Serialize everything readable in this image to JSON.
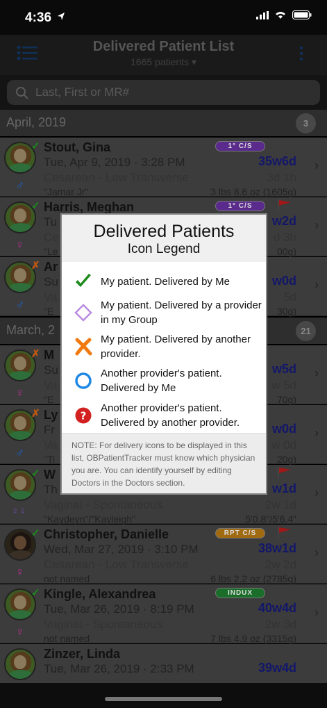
{
  "status_bar": {
    "time": "4:36"
  },
  "nav": {
    "title": "Delivered Patient List",
    "subtitle": "1665 patients ▾"
  },
  "search": {
    "placeholder": "Last, First or MR#"
  },
  "sections": [
    {
      "title": "April, 2019",
      "count": "3"
    },
    {
      "title": "March, 2",
      "count": "21"
    }
  ],
  "rows": [
    {
      "name": "Stout, Gina",
      "date": "Tue, Apr 9, 2019 · 3:28 PM",
      "delivery": "Cesarean - Low Transverse",
      "baby": "\"Jamar Jr\"",
      "age": "35w6d",
      "since": "3d 1h",
      "weight": "3 lbs 8.6 oz (1605g)",
      "badge": "1° C/S",
      "gender": "♂"
    },
    {
      "name": "Harris, Meghan",
      "date": "Tu",
      "delivery": "Ce",
      "baby": "\"Le",
      "age": "w2d",
      "since": "d 3h",
      "weight": "00g)",
      "badge": "1° C/S",
      "gender": "♀"
    },
    {
      "name": "Ar",
      "date": "Su",
      "delivery": "Va",
      "baby": "\"E",
      "age": "w0d",
      "since": "5d",
      "weight": "30g)",
      "badge": "",
      "gender": "♂"
    },
    {
      "name": "M",
      "date": "Su",
      "delivery": "Va",
      "baby": "\"E",
      "age": "w5d",
      "since": "w 5d",
      "weight": "70g)",
      "badge": "",
      "gender": "♀"
    },
    {
      "name": "Ly",
      "date": "Fr",
      "delivery": "Va",
      "baby": "\"Ti",
      "age": "w0d",
      "since": "w 0d",
      "weight": "20g)",
      "badge": "",
      "gender": "♂"
    },
    {
      "name": "W",
      "date": "Th",
      "delivery": "Vaginal - Spontaneous",
      "baby": "\"Kaydeyn\"/\"Kayleigh\"",
      "age": "w1d",
      "since": "2w 1d",
      "weight": "5'0.8\"/5'6.4\"",
      "badge": "",
      "gender": "twins"
    },
    {
      "name": "Christopher, Danielle",
      "date": "Wed, Mar 27, 2019 · 3:10 PM",
      "delivery": "Cesarean - Low Transverse",
      "baby": "not named",
      "age": "38w1d",
      "since": "2w 2d",
      "weight": "6 lbs 2.2 oz (2785g)",
      "badge": "RPT C/S",
      "gender": "♀"
    },
    {
      "name": "Kingle, Alexandrea",
      "date": "Tue, Mar 26, 2019 · 8:19 PM",
      "delivery": "Vaginal - Spontaneous",
      "baby": "not named",
      "age": "40w4d",
      "since": "2w 3d",
      "weight": "7 lbs 4.9 oz (3315g)",
      "badge": "INDUX",
      "gender": "♀"
    },
    {
      "name": "Zinzer, Linda",
      "date": "Tue, Mar 26, 2019 · 2:33 PM",
      "delivery": "",
      "baby": "",
      "age": "39w4d",
      "since": "",
      "weight": "",
      "badge": "",
      "gender": ""
    }
  ],
  "legend": {
    "title": "Delivered Patients",
    "subtitle": "Icon Legend",
    "items": [
      {
        "icon": "check-icon",
        "text": "My patient.  Delivered by Me"
      },
      {
        "icon": "diamond-icon",
        "text": "My patient.  Delivered by a provider in my Group"
      },
      {
        "icon": "x-icon",
        "text": "My patient. Delivered by another provider."
      },
      {
        "icon": "circle-icon",
        "text": "Another provider's patient. Delivered by Me"
      },
      {
        "icon": "question-icon",
        "text": "Another provider's patient. Delivered by another provider."
      }
    ],
    "note": "NOTE: For delivery icons to be displayed in this list, OBPatientTracker must know which physician you are. You can identify yourself by editing Doctors in the Doctors section."
  },
  "colors": {
    "check": "#1b8a1b",
    "diamond": "#b98be0",
    "x": "#f07a10",
    "circle": "#1e88e5",
    "question": "#d32020",
    "age_text": "#13176a"
  }
}
